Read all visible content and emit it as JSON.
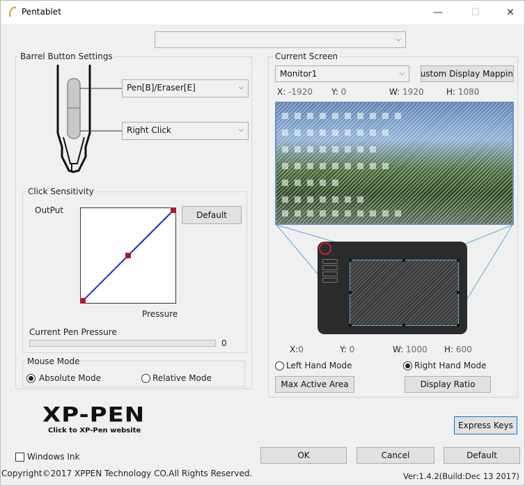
{
  "window": {
    "title": "Pentablet",
    "minimize": "—",
    "maximize": "☐",
    "close": "✕"
  },
  "top_combo": {
    "value": ""
  },
  "barrel": {
    "group_label": "Barrel Button Settings",
    "upper_value": "Pen[B]/Eraser[E]",
    "lower_value": "Right Click"
  },
  "sensitivity": {
    "group_label": "Click Sensitivity",
    "output_label": "OutPut",
    "pressure_label": "Pressure",
    "default_button": "Default",
    "curve_points": [
      [
        0,
        0
      ],
      [
        0.5,
        0.5
      ],
      [
        1,
        1
      ]
    ]
  },
  "pen_pressure": {
    "label": "Current Pen Pressure",
    "value": "0",
    "fraction": 0
  },
  "mouse_mode": {
    "group_label": "Mouse Mode",
    "absolute": "Absolute Mode",
    "relative": "Relative Mode",
    "selected": "absolute"
  },
  "current_screen": {
    "group_label": "Current Screen",
    "monitor_value": "Monitor1",
    "custom_button": "ustom Display Mappin",
    "x_label": "X:",
    "x_value": "-1920",
    "y_label": "Y:",
    "y_value": "0",
    "w_label": "W:",
    "w_value": "1920",
    "h_label": "H:",
    "h_value": "1080"
  },
  "tablet_area": {
    "x_label": "X:",
    "x_value": "0",
    "y_label": "Y:",
    "y_value": "0",
    "w_label": "W:",
    "w_value": "1000",
    "h_label": "H:",
    "h_value": "600",
    "left_hand": "Left Hand Mode",
    "right_hand": "Right Hand Mode",
    "hand_selected": "right",
    "max_active_area": "Max Active Area",
    "display_ratio": "Display Ratio"
  },
  "logo": {
    "text": "XP-PEN",
    "subtext": "Click to XP-Pen website"
  },
  "express_keys": "Express Keys",
  "windows_ink": {
    "label": "Windows Ink",
    "checked": false
  },
  "footer": {
    "ok": "OK",
    "cancel": "Cancel",
    "default": "Default",
    "copyright": "Copyright©2017 XPPEN Technology CO.All Rights Reserved.",
    "version": "Ver:1.4.2(Build:Dec 13 2017)"
  },
  "colors": {
    "accent": "#0078d7",
    "curve": "#1f2fb8",
    "curve_point": "#b0143a",
    "area_border": "#5ea9d6"
  }
}
